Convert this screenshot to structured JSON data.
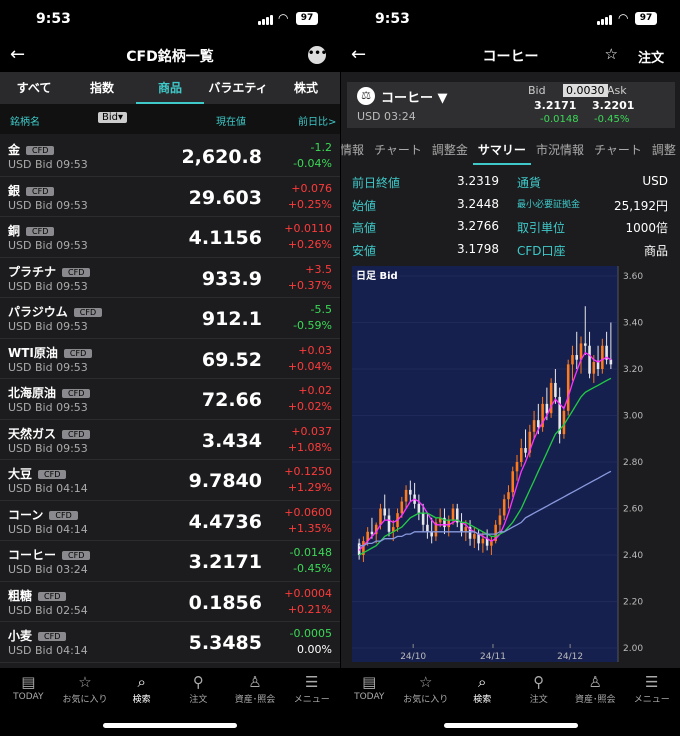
{
  "left": {
    "status": {
      "time": "9:53",
      "battery": "97"
    },
    "nav": {
      "title": "CFD銘柄一覧"
    },
    "tabs": [
      "すべて",
      "指数",
      "商品",
      "バラエティ",
      "株式"
    ],
    "active_tab": "商品",
    "columns": {
      "name": "銘柄名",
      "sort": "Bid▾",
      "price": "現在値",
      "change": "前日比>"
    },
    "rows": [
      {
        "name": "金",
        "tag": "CFD",
        "sub": "USD Bid 09:53",
        "price": "2,620.8",
        "c1": "-1.2",
        "c2": "-0.04%",
        "dir": "dn"
      },
      {
        "name": "銀",
        "tag": "CFD",
        "sub": "USD Bid 09:53",
        "price": "29.603",
        "c1": "+0.076",
        "c2": "+0.25%",
        "dir": "up"
      },
      {
        "name": "銅",
        "tag": "CFD",
        "sub": "USD Bid 09:53",
        "price": "4.1156",
        "c1": "+0.0110",
        "c2": "+0.26%",
        "dir": "up"
      },
      {
        "name": "プラチナ",
        "tag": "CFD",
        "sub": "USD Bid 09:53",
        "price": "933.9",
        "c1": "+3.5",
        "c2": "+0.37%",
        "dir": "up"
      },
      {
        "name": "パラジウム",
        "tag": "CFD",
        "sub": "USD Bid 09:53",
        "price": "912.1",
        "c1": "-5.5",
        "c2": "-0.59%",
        "dir": "dn"
      },
      {
        "name": "WTI原油",
        "tag": "CFD",
        "sub": "USD Bid 09:53",
        "price": "69.52",
        "c1": "+0.03",
        "c2": "+0.04%",
        "dir": "up"
      },
      {
        "name": "北海原油",
        "tag": "CFD",
        "sub": "USD Bid 09:53",
        "price": "72.66",
        "c1": "+0.02",
        "c2": "+0.02%",
        "dir": "up"
      },
      {
        "name": "天然ガス",
        "tag": "CFD",
        "sub": "USD Bid 09:53",
        "price": "3.434",
        "c1": "+0.037",
        "c2": "+1.08%",
        "dir": "up"
      },
      {
        "name": "大豆",
        "tag": "CFD",
        "sub": "USD Bid 04:14",
        "price": "9.7840",
        "c1": "+0.1250",
        "c2": "+1.29%",
        "dir": "up"
      },
      {
        "name": "コーン",
        "tag": "CFD",
        "sub": "USD Bid 04:14",
        "price": "4.4736",
        "c1": "+0.0600",
        "c2": "+1.35%",
        "dir": "up"
      },
      {
        "name": "コーヒー",
        "tag": "CFD",
        "sub": "USD Bid 03:24",
        "price": "3.2171",
        "c1": "-0.0148",
        "c2": "-0.45%",
        "dir": "dn"
      },
      {
        "name": "粗糖",
        "tag": "CFD",
        "sub": "USD Bid 02:54",
        "price": "0.1856",
        "c1": "+0.0004",
        "c2": "+0.21%",
        "dir": "up"
      },
      {
        "name": "小麦",
        "tag": "CFD",
        "sub": "USD Bid 04:14",
        "price": "5.3485",
        "c1": "-0.0005",
        "c2": "0.00%",
        "dir": "dn"
      }
    ]
  },
  "bottom_nav": [
    "TODAY",
    "お気に入り",
    "検索",
    "注文",
    "資産･照会",
    "メニュー"
  ],
  "bottom_nav_active": "検索",
  "right": {
    "status": {
      "time": "9:53",
      "battery": "97"
    },
    "nav": {
      "title": "コーヒー",
      "order": "注文"
    },
    "ticker": {
      "name": "コーヒー ▼",
      "time": "USD 03:24",
      "bid_label": "Bid",
      "spread": "0.0030",
      "ask_label": "Ask",
      "bid": "3.2171",
      "ask": "3.2201",
      "bid_change": "-0.0148",
      "ask_change": "-0.45%"
    },
    "subtabs": [
      "情報",
      "チャート",
      "調整金",
      "サマリー",
      "市況情報",
      "チャート",
      "調整"
    ],
    "active_subtab": "サマリー",
    "summary": [
      {
        "k1": "前日終値",
        "v1": "3.2319",
        "k2": "通貨",
        "v2": "USD"
      },
      {
        "k1": "始値",
        "v1": "3.2448",
        "k2": "最小必要証拠金",
        "v2": "25,192円"
      },
      {
        "k1": "高値",
        "v1": "3.2766",
        "k2": "取引単位",
        "v2": "1000倍"
      },
      {
        "k1": "安値",
        "v1": "3.1798",
        "k2": "CFD口座",
        "v2": "商品"
      }
    ]
  },
  "chart_data": {
    "type": "candlestick",
    "title": "日足 Bid",
    "ylim": [
      2.0,
      3.6
    ],
    "yticks": [
      "3.60",
      "3.40",
      "3.20",
      "3.00",
      "2.80",
      "2.60",
      "2.40",
      "2.20",
      "2.00"
    ],
    "xticks": [
      "24/10",
      "24/11",
      "24/12"
    ],
    "background": "#16204f",
    "candles": [
      [
        2.45,
        2.47,
        2.38,
        2.4
      ],
      [
        2.4,
        2.48,
        2.37,
        2.46
      ],
      [
        2.46,
        2.52,
        2.44,
        2.5
      ],
      [
        2.5,
        2.56,
        2.47,
        2.49
      ],
      [
        2.49,
        2.54,
        2.45,
        2.53
      ],
      [
        2.53,
        2.62,
        2.51,
        2.6
      ],
      [
        2.6,
        2.66,
        2.55,
        2.57
      ],
      [
        2.57,
        2.6,
        2.48,
        2.5
      ],
      [
        2.5,
        2.55,
        2.46,
        2.52
      ],
      [
        2.52,
        2.6,
        2.5,
        2.58
      ],
      [
        2.58,
        2.65,
        2.56,
        2.63
      ],
      [
        2.63,
        2.7,
        2.6,
        2.68
      ],
      [
        2.68,
        2.72,
        2.63,
        2.66
      ],
      [
        2.66,
        2.71,
        2.6,
        2.62
      ],
      [
        2.62,
        2.66,
        2.55,
        2.58
      ],
      [
        2.58,
        2.62,
        2.5,
        2.53
      ],
      [
        2.53,
        2.58,
        2.47,
        2.5
      ],
      [
        2.5,
        2.56,
        2.45,
        2.48
      ],
      [
        2.48,
        2.56,
        2.46,
        2.54
      ],
      [
        2.54,
        2.6,
        2.52,
        2.56
      ],
      [
        2.56,
        2.6,
        2.49,
        2.52
      ],
      [
        2.52,
        2.57,
        2.48,
        2.55
      ],
      [
        2.55,
        2.62,
        2.53,
        2.6
      ],
      [
        2.6,
        2.62,
        2.52,
        2.54
      ],
      [
        2.54,
        2.58,
        2.48,
        2.5
      ],
      [
        2.5,
        2.55,
        2.46,
        2.52
      ],
      [
        2.52,
        2.55,
        2.44,
        2.47
      ],
      [
        2.47,
        2.52,
        2.43,
        2.49
      ],
      [
        2.49,
        2.51,
        2.42,
        2.45
      ],
      [
        2.45,
        2.5,
        2.41,
        2.47
      ],
      [
        2.47,
        2.51,
        2.42,
        2.44
      ],
      [
        2.44,
        2.48,
        2.4,
        2.46
      ],
      [
        2.46,
        2.55,
        2.45,
        2.53
      ],
      [
        2.53,
        2.6,
        2.5,
        2.57
      ],
      [
        2.57,
        2.66,
        2.55,
        2.64
      ],
      [
        2.64,
        2.7,
        2.6,
        2.67
      ],
      [
        2.67,
        2.78,
        2.65,
        2.76
      ],
      [
        2.76,
        2.83,
        2.72,
        2.8
      ],
      [
        2.8,
        2.9,
        2.78,
        2.86
      ],
      [
        2.86,
        2.94,
        2.82,
        2.84
      ],
      [
        2.84,
        2.96,
        2.82,
        2.93
      ],
      [
        2.93,
        3.02,
        2.9,
        2.98
      ],
      [
        2.98,
        3.05,
        2.92,
        2.95
      ],
      [
        2.95,
        3.08,
        2.93,
        3.05
      ],
      [
        3.05,
        3.12,
        2.98,
        3.01
      ],
      [
        3.01,
        3.16,
        2.99,
        3.14
      ],
      [
        3.14,
        3.2,
        3.05,
        3.08
      ],
      [
        3.08,
        3.12,
        2.88,
        2.92
      ],
      [
        2.92,
        3.04,
        2.9,
        3.02
      ],
      [
        3.02,
        3.24,
        3.0,
        3.22
      ],
      [
        3.22,
        3.3,
        3.15,
        3.26
      ],
      [
        3.26,
        3.36,
        3.2,
        3.24
      ],
      [
        3.24,
        3.34,
        3.18,
        3.31
      ],
      [
        3.31,
        3.47,
        3.26,
        3.3
      ],
      [
        3.3,
        3.36,
        3.16,
        3.18
      ],
      [
        3.18,
        3.26,
        3.14,
        3.23
      ],
      [
        3.23,
        3.3,
        3.17,
        3.2
      ],
      [
        3.2,
        3.33,
        3.18,
        3.3
      ],
      [
        3.3,
        3.36,
        3.22,
        3.24
      ],
      [
        3.24,
        3.4,
        3.2,
        3.22
      ]
    ],
    "series": [
      {
        "color": "#ff33ff",
        "values": [
          2.42,
          2.44,
          2.46,
          2.48,
          2.5,
          2.53,
          2.55,
          2.55,
          2.54,
          2.55,
          2.57,
          2.6,
          2.63,
          2.64,
          2.63,
          2.61,
          2.58,
          2.55,
          2.53,
          2.53,
          2.53,
          2.53,
          2.54,
          2.55,
          2.54,
          2.53,
          2.51,
          2.5,
          2.49,
          2.48,
          2.47,
          2.46,
          2.47,
          2.49,
          2.53,
          2.58,
          2.64,
          2.7,
          2.76,
          2.8,
          2.85,
          2.9,
          2.94,
          2.97,
          3.0,
          3.04,
          3.07,
          3.05,
          3.03,
          3.08,
          3.14,
          3.19,
          3.24,
          3.27,
          3.26,
          3.24,
          3.23,
          3.24,
          3.25,
          3.24
        ]
      },
      {
        "color": "#22cc44",
        "values": [
          2.4,
          2.41,
          2.42,
          2.43,
          2.44,
          2.46,
          2.48,
          2.49,
          2.5,
          2.51,
          2.52,
          2.54,
          2.56,
          2.57,
          2.58,
          2.58,
          2.58,
          2.57,
          2.56,
          2.56,
          2.55,
          2.55,
          2.55,
          2.55,
          2.54,
          2.54,
          2.53,
          2.52,
          2.51,
          2.5,
          2.49,
          2.48,
          2.48,
          2.49,
          2.5,
          2.52,
          2.54,
          2.57,
          2.6,
          2.64,
          2.68,
          2.72,
          2.76,
          2.8,
          2.84,
          2.88,
          2.92,
          2.94,
          2.96,
          2.99,
          3.02,
          3.05,
          3.08,
          3.1,
          3.11,
          3.12,
          3.13,
          3.14,
          3.15,
          3.16
        ]
      },
      {
        "color": "#8899dd",
        "values": [
          2.44,
          2.44,
          2.45,
          2.45,
          2.46,
          2.46,
          2.47,
          2.47,
          2.47,
          2.48,
          2.48,
          2.49,
          2.49,
          2.5,
          2.5,
          2.5,
          2.5,
          2.5,
          2.5,
          2.5,
          2.5,
          2.5,
          2.5,
          2.5,
          2.5,
          2.5,
          2.5,
          2.5,
          2.49,
          2.49,
          2.49,
          2.49,
          2.49,
          2.5,
          2.5,
          2.51,
          2.52,
          2.53,
          2.54,
          2.56,
          2.57,
          2.58,
          2.59,
          2.6,
          2.61,
          2.62,
          2.63,
          2.64,
          2.65,
          2.66,
          2.67,
          2.68,
          2.69,
          2.7,
          2.71,
          2.72,
          2.73,
          2.74,
          2.75,
          2.76
        ]
      }
    ]
  }
}
